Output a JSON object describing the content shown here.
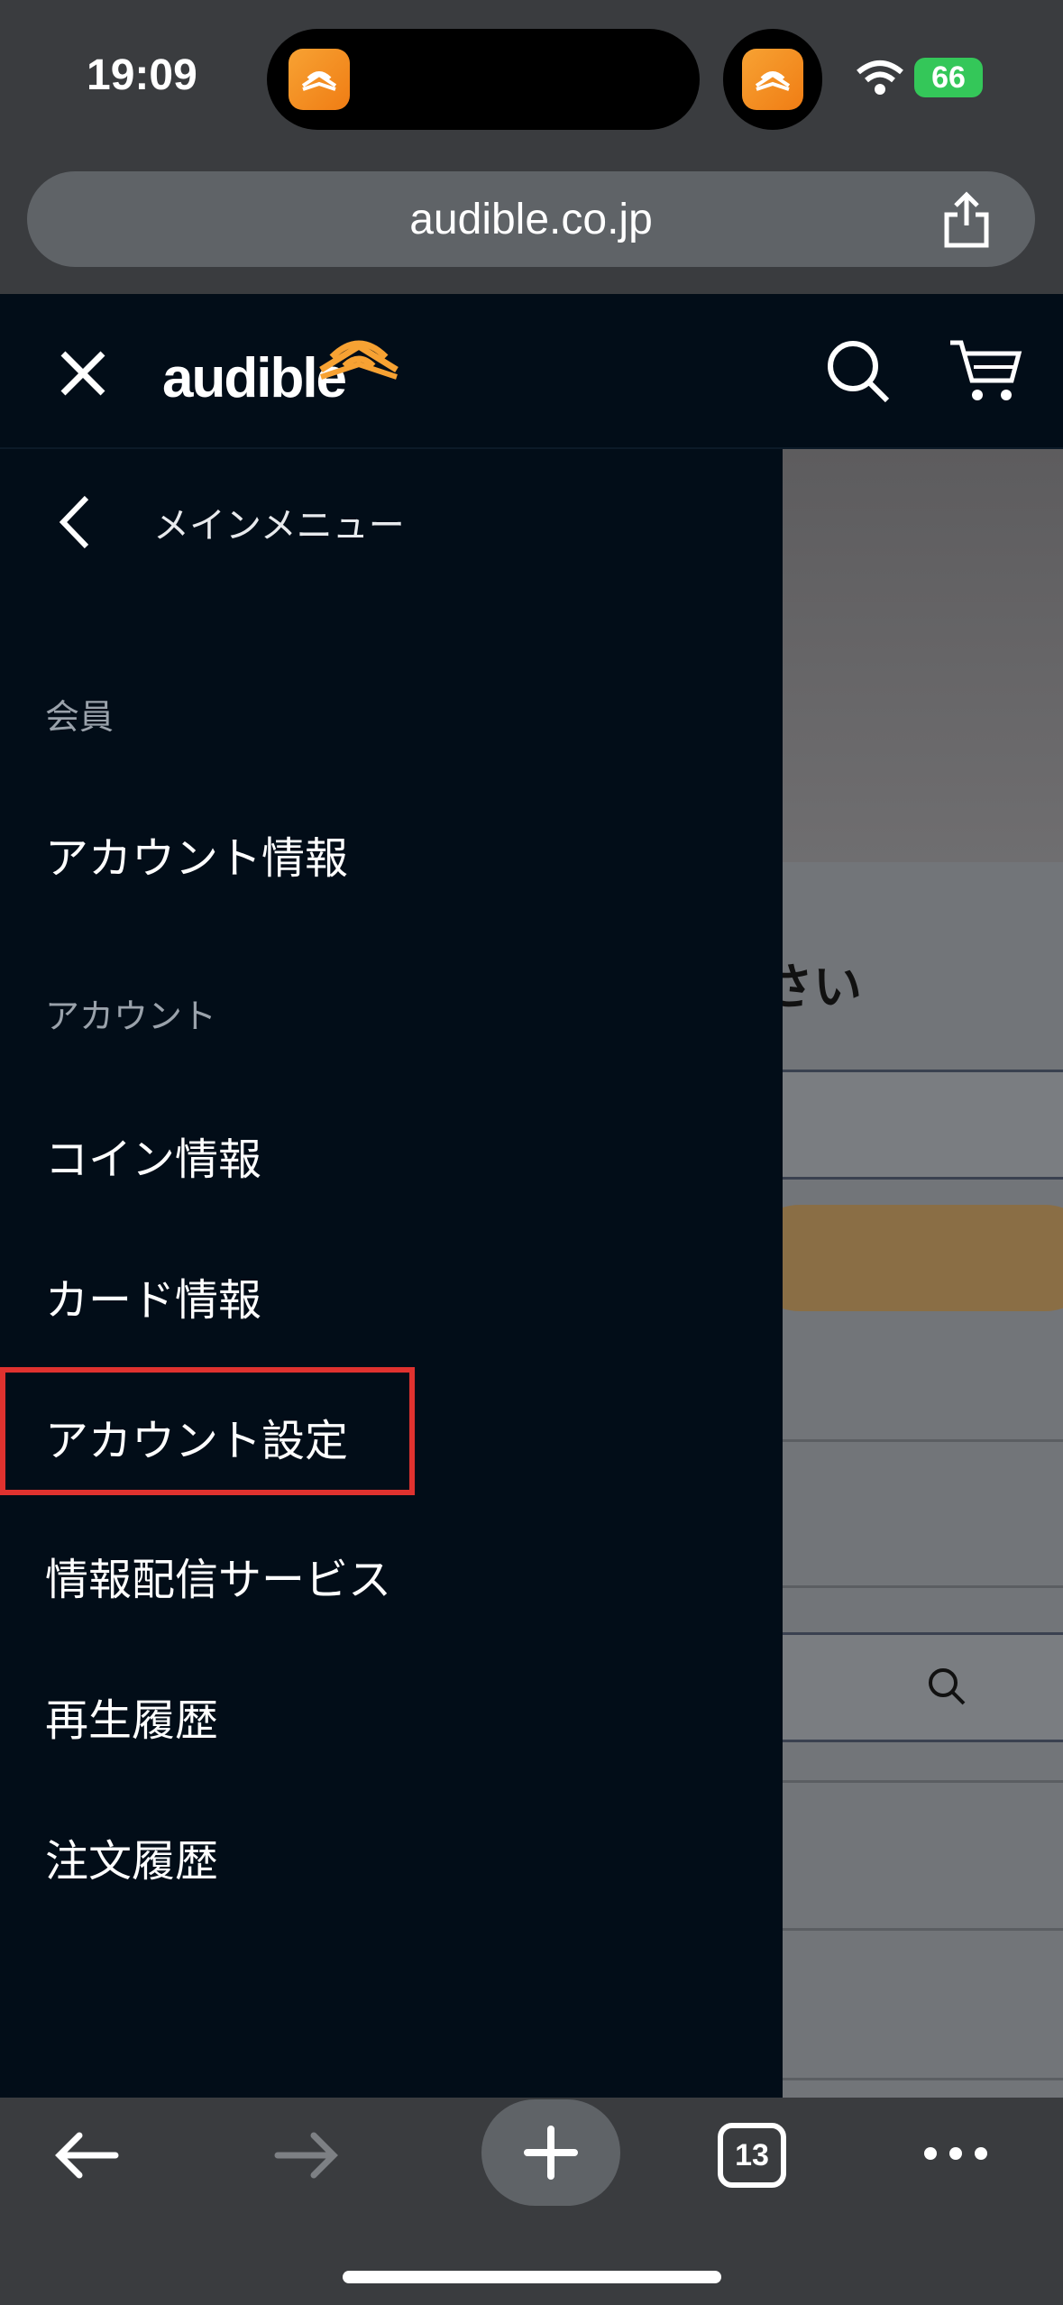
{
  "status": {
    "time": "19:09",
    "battery": "66"
  },
  "browser": {
    "url": "audible.co.jp",
    "tab_count": "13"
  },
  "header": {
    "logo_text": "audible"
  },
  "drawer": {
    "back_label": "メインメニュー",
    "sections": [
      {
        "label": "会員",
        "items": [
          "アカウント情報"
        ]
      },
      {
        "label": "アカウント",
        "items": [
          "コイン情報",
          "カード情報",
          "アカウント設定",
          "情報配信サービス",
          "再生履歴",
          "注文履歴"
        ]
      }
    ],
    "highlighted_item": "アカウント設定"
  },
  "background_page": {
    "heading_fragment": "さい"
  },
  "colors": {
    "drawer_bg": "#020d18",
    "accent": "#f7a233",
    "highlight": "#e0322f",
    "chrome": "#3a3c3f"
  }
}
